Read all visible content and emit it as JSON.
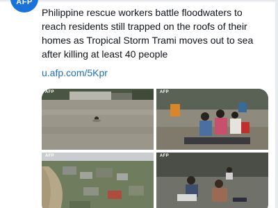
{
  "header": {
    "avatar_text": "AFP",
    "fragment": "..."
  },
  "tweet": {
    "text": "Philippine rescue workers battle floodwaters to reach residents still trapped on the roofs of their homes as Tropical Storm Trami moves out to sea after killing at least 40 people",
    "link": "u.afp.com/5Kpr"
  },
  "media": [
    {
      "watermark": "AFP",
      "subject": "person swimming in floodwater near flooded houses"
    },
    {
      "watermark": "AFP",
      "subject": "residents evacuating on a boat through flooded street"
    },
    {
      "watermark": "AFP",
      "subject": "aerial view of flooded town and river"
    },
    {
      "watermark": "AFP",
      "subject": "men wading through floodwater"
    }
  ],
  "colors": {
    "avatar": "#1a73d9",
    "link": "#1d6fb8",
    "text": "#0f1419"
  }
}
